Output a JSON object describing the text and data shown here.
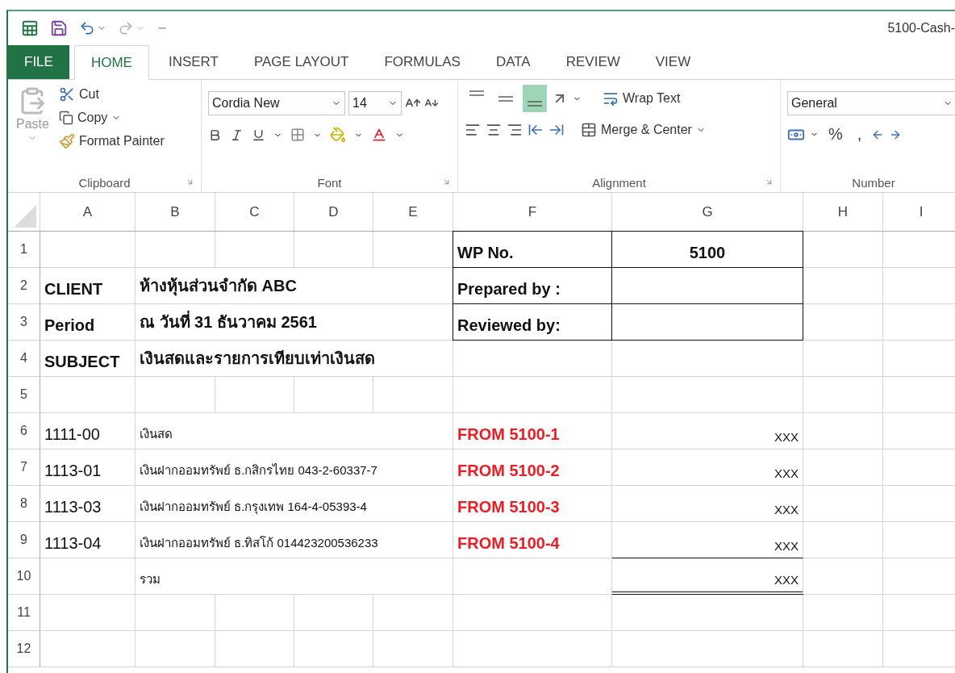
{
  "quick_access": {
    "undo": {
      "disabled": false
    },
    "redo": {
      "disabled": true
    },
    "title": "5100-Cash-"
  },
  "tabs": [
    {
      "label": "FILE",
      "kind": "file",
      "selected": false
    },
    {
      "label": "HOME",
      "kind": "tab",
      "selected": true
    },
    {
      "label": "INSERT",
      "kind": "tab",
      "selected": false
    },
    {
      "label": "PAGE LAYOUT",
      "kind": "tab",
      "selected": false
    },
    {
      "label": "FORMULAS",
      "kind": "tab",
      "selected": false
    },
    {
      "label": "DATA",
      "kind": "tab",
      "selected": false
    },
    {
      "label": "REVIEW",
      "kind": "tab",
      "selected": false
    },
    {
      "label": "VIEW",
      "kind": "tab",
      "selected": false
    }
  ],
  "ribbon": {
    "clipboard": {
      "paste": {
        "label": "Paste",
        "disabled": true
      },
      "cut": "Cut",
      "copy": "Copy",
      "format_painter": "Format Painter",
      "label": "Clipboard"
    },
    "font": {
      "name": "Cordia New",
      "size": "14",
      "label": "Font"
    },
    "alignment": {
      "vertical": [
        {
          "kind": "top",
          "selected": false
        },
        {
          "kind": "middle",
          "selected": false
        },
        {
          "kind": "bottom",
          "selected": true
        }
      ],
      "wrap_text": "Wrap Text",
      "merge": "Merge & Center",
      "label": "Alignment"
    },
    "number": {
      "format": "General",
      "percent": "%",
      "comma": ",",
      "label": "Number"
    }
  },
  "sheet": {
    "columns": [
      "A",
      "B",
      "C",
      "D",
      "E",
      "F",
      "G",
      "H",
      "I"
    ],
    "rows": [
      {
        "number": "1",
        "cells": {
          "F": {
            "text": "WP No.",
            "bold": true,
            "boxed": true
          },
          "G": {
            "text": "5100",
            "bold": true,
            "centered": true,
            "boxed": true
          }
        }
      },
      {
        "number": "2",
        "cells": {
          "A": {
            "text": "CLIENT",
            "bold": true
          },
          "B": {
            "text": "ห้างหุ้นส่วนจำกัด ABC",
            "bold": true
          },
          "F": {
            "text": "Prepared by :",
            "bold": true,
            "boxed": true
          },
          "G": {
            "boxed": true
          }
        }
      },
      {
        "number": "3",
        "cells": {
          "A": {
            "text": "Period",
            "bold": true
          },
          "B": {
            "text": "ณ วันที่ 31 ธันวาคม 2561",
            "bold": true
          },
          "F": {
            "text": "Reviewed by:",
            "bold": true,
            "boxed": true
          },
          "G": {
            "boxed": true
          }
        }
      },
      {
        "number": "4",
        "cells": {
          "A": {
            "text": "SUBJECT",
            "bold": true
          },
          "B": {
            "text": "เงินสดและรายการเทียบเท่าเงินสด",
            "bold": true
          }
        }
      },
      {
        "number": "5"
      },
      {
        "number": "6",
        "cells": {
          "A": {
            "text": "1111-00"
          },
          "B": {
            "text": "เงินสด"
          },
          "F": {
            "text": "FROM 5100-1",
            "bold": true,
            "color": "#ee1c24"
          },
          "G": {
            "text": "XXX",
            "right_aligned": true
          }
        }
      },
      {
        "number": "7",
        "cells": {
          "A": {
            "text": "1113-01"
          },
          "B": {
            "text": "เงินฝากออมทรัพย์ ธ.กสิกรไทย 043-2-60337-7"
          },
          "F": {
            "text": "FROM 5100-2",
            "bold": true,
            "color": "#ee1c24"
          },
          "G": {
            "text": "XXX",
            "right_aligned": true
          }
        }
      },
      {
        "number": "8",
        "cells": {
          "A": {
            "text": "1113-03"
          },
          "B": {
            "text": "เงินฝากออมทรัพย์ ธ.กรุงเทพ 164-4-05393-4"
          },
          "F": {
            "text": "FROM 5100-3",
            "bold": true,
            "color": "#ee1c24"
          },
          "G": {
            "text": "XXX",
            "right_aligned": true
          }
        }
      },
      {
        "number": "9",
        "cells": {
          "A": {
            "text": "1113-04"
          },
          "B": {
            "text": "เงินฝากออมทรัพย์ ธ.ทิสโก้ 014423200536233"
          },
          "F": {
            "text": "FROM 5100-4",
            "bold": true,
            "color": "#ee1c24"
          },
          "G": {
            "text": "XXX",
            "right_aligned": true,
            "rule_below": true
          }
        }
      },
      {
        "number": "10",
        "cells": {
          "B": {
            "text": "รวม"
          },
          "G": {
            "text": "XXX",
            "right_aligned": true,
            "double_rule_below": true
          }
        }
      },
      {
        "number": "11"
      },
      {
        "number": "12"
      }
    ]
  }
}
